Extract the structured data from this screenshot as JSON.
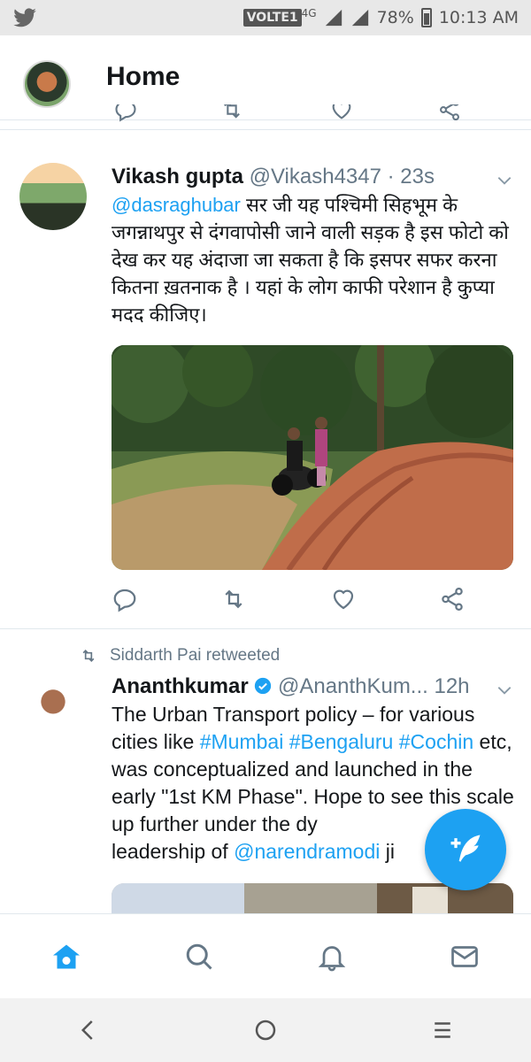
{
  "status_bar": {
    "network": "VOLTE1",
    "network_type": "4G",
    "battery": "78%",
    "time": "10:13 AM"
  },
  "header": {
    "title": "Home"
  },
  "tweets": [
    {
      "name": "Vikash gupta",
      "handle": "@Vikash4347",
      "time": "· 23s",
      "mention": "@dasraghubar",
      "text": " सर जी यह पश्चिमी सिहभूम के जगन्नाथपुर से दंगवापोसी जाने वाली सड़क है इस फोटो को देख कर यह अंदाजा जा सकता है कि इसपर सफर करना कितना ख़तनाक है । यहां के लोग काफी परेशान है कुप्या मदद  कीजिए।"
    },
    {
      "retweeted_by": "Siddarth Pai retweeted",
      "name": "Ananthkumar",
      "handle": "@AnanthKum...",
      "time": "12h",
      "text_1": "The Urban Transport policy – for various cities like ",
      "hashtag_1": "#Mumbai",
      "hashtag_2": "#Bengaluru",
      "hashtag_3": "#Cochin",
      "text_2": " etc, was conceptualized and launched in the early \"1st KM Phase\". Hope to see this scale up further under the dy",
      "text_3": "leadership of ",
      "mention": "@narendramodi",
      "text_4": " ji"
    }
  ],
  "icons": {
    "reply": "reply-icon",
    "retweet": "retweet-icon",
    "like": "heart-icon",
    "share": "share-icon",
    "compose": "compose-tweet-icon",
    "home": "home-icon",
    "search": "search-icon",
    "notifications": "bell-icon",
    "messages": "mail-icon"
  },
  "colors": {
    "accent": "#1da1f2",
    "text": "#14171a",
    "muted": "#657786"
  }
}
